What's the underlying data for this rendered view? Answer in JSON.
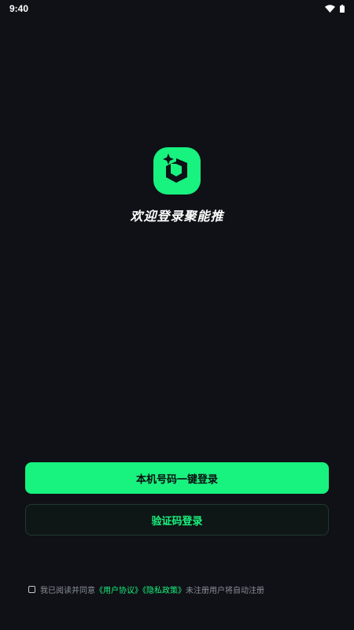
{
  "status_bar": {
    "time": "9:40",
    "icons": [
      "wifi-icon",
      "battery-icon"
    ]
  },
  "logo": {
    "icon": "app-logo-icon",
    "color": "#18f27f"
  },
  "welcome_text": "欢迎登录聚能推",
  "buttons": {
    "one_click_login": "本机号码一键登录",
    "code_login": "验证码登录"
  },
  "agreement": {
    "prefix": "我已阅读并同意",
    "user_agreement": "《用户协议》",
    "privacy_policy": "《隐私政策》",
    "suffix": "未注册用户将自动注册",
    "checked": false
  },
  "colors": {
    "background": "#0f1116",
    "accent": "#18f27f",
    "muted_text": "#8a8f98"
  }
}
